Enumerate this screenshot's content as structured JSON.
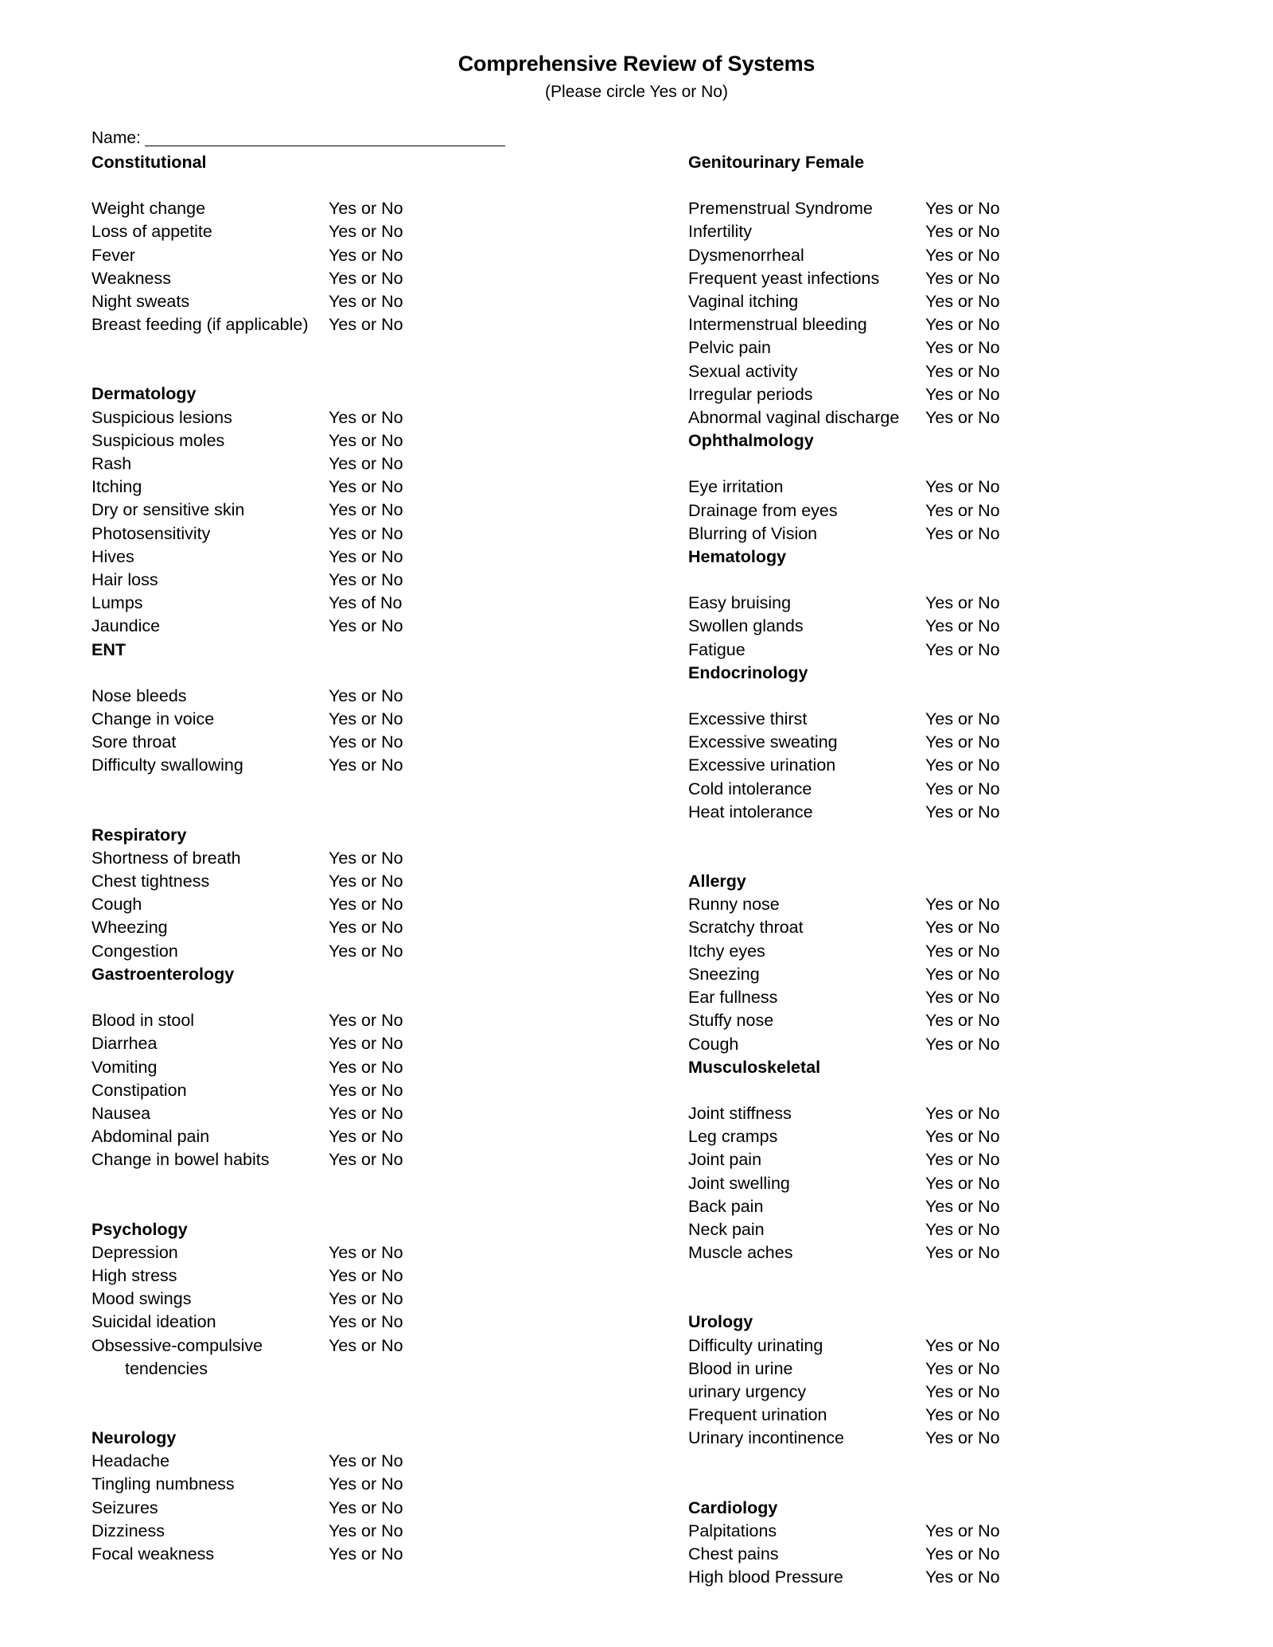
{
  "header": {
    "title": "Comprehensive Review of Systems",
    "subtitle": "(Please circle Yes or No)"
  },
  "name_field": {
    "label": "Name:",
    "value": ""
  },
  "answer_default": "Yes or No",
  "left_column": [
    {
      "heading": "Constitutional",
      "gap_after_heading": true,
      "space_before": false,
      "items": [
        {
          "label": "Weight change",
          "answer": "Yes or No"
        },
        {
          "label": "Loss of appetite",
          "answer": "Yes or No"
        },
        {
          "label": "Fever",
          "answer": "Yes or No"
        },
        {
          "label": "Weakness",
          "answer": "Yes or No"
        },
        {
          "label": "Night sweats",
          "answer": "Yes or No"
        },
        {
          "label": "Breast feeding (if applicable)",
          "answer": "Yes or No"
        }
      ]
    },
    {
      "heading": "Dermatology",
      "gap_after_heading": false,
      "space_before": true,
      "items": [
        {
          "label": "Suspicious lesions",
          "answer": "Yes or No"
        },
        {
          "label": "Suspicious moles",
          "answer": "Yes or No"
        },
        {
          "label": "Rash",
          "answer": "Yes or No"
        },
        {
          "label": "Itching",
          "answer": "Yes or No"
        },
        {
          "label": "Dry or sensitive skin",
          "answer": "Yes or No"
        },
        {
          "label": "Photosensitivity",
          "answer": "Yes or No"
        },
        {
          "label": "Hives",
          "answer": "Yes or No"
        },
        {
          "label": "Hair loss",
          "answer": "Yes or No"
        },
        {
          "label": "Lumps",
          "answer": "Yes of No"
        },
        {
          "label": "Jaundice",
          "answer": "Yes or No"
        }
      ]
    },
    {
      "heading": "ENT",
      "gap_after_heading": true,
      "space_before": false,
      "items": [
        {
          "label": "Nose bleeds",
          "answer": "Yes or No"
        },
        {
          "label": "Change in voice",
          "answer": "Yes or No"
        },
        {
          "label": "Sore throat",
          "answer": "Yes or No"
        },
        {
          "label": "Difficulty swallowing",
          "answer": "Yes or No"
        }
      ]
    },
    {
      "heading": "Respiratory",
      "gap_after_heading": false,
      "space_before": true,
      "items": [
        {
          "label": "Shortness of breath",
          "answer": "Yes or No"
        },
        {
          "label": "Chest tightness",
          "answer": "Yes or No"
        },
        {
          "label": "Cough",
          "answer": "Yes or No"
        },
        {
          "label": "Wheezing",
          "answer": "Yes or No"
        },
        {
          "label": "Congestion",
          "answer": "Yes or No"
        }
      ]
    },
    {
      "heading": "Gastroenterology",
      "gap_after_heading": true,
      "space_before": false,
      "items": [
        {
          "label": "Blood in stool",
          "answer": "Yes or No"
        },
        {
          "label": "Diarrhea",
          "answer": "Yes or No"
        },
        {
          "label": "Vomiting",
          "answer": "Yes or No"
        },
        {
          "label": "Constipation",
          "answer": "Yes or No"
        },
        {
          "label": "Nausea",
          "answer": "Yes or No"
        },
        {
          "label": "Abdominal pain",
          "answer": "Yes or No"
        },
        {
          "label": "Change in bowel habits",
          "answer": "Yes or No"
        }
      ]
    },
    {
      "heading": "Psychology",
      "gap_after_heading": false,
      "space_before": true,
      "items": [
        {
          "label": "Depression",
          "answer": "Yes or No"
        },
        {
          "label": "High stress",
          "answer": "Yes or No"
        },
        {
          "label": "Mood swings",
          "answer": "Yes or No"
        },
        {
          "label": "Suicidal ideation",
          "answer": "Yes or No"
        },
        {
          "label": "Obsessive-compulsive",
          "answer": "Yes or No"
        },
        {
          "label": "tendencies",
          "answer": "",
          "continuation": true
        }
      ]
    },
    {
      "heading": "Neurology",
      "gap_after_heading": false,
      "space_before": true,
      "items": [
        {
          "label": "Headache",
          "answer": "Yes or No"
        },
        {
          "label": "Tingling numbness",
          "answer": "Yes or No"
        },
        {
          "label": "Seizures",
          "answer": "Yes or No"
        },
        {
          "label": "Dizziness",
          "answer": "Yes or No"
        },
        {
          "label": "Focal weakness",
          "answer": "Yes or No"
        }
      ]
    }
  ],
  "right_column": [
    {
      "heading": "Genitourinary Female",
      "gap_after_heading": true,
      "space_before": false,
      "items": [
        {
          "label": "Premenstrual Syndrome",
          "answer": "Yes or No"
        },
        {
          "label": "Infertility",
          "answer": "Yes or No"
        },
        {
          "label": "Dysmenorrheal",
          "answer": "Yes or No"
        },
        {
          "label": "Frequent yeast infections",
          "answer": "Yes or No"
        },
        {
          "label": "Vaginal itching",
          "answer": "Yes or No"
        },
        {
          "label": "Intermenstrual bleeding",
          "answer": "Yes or No"
        },
        {
          "label": "Pelvic pain",
          "answer": "Yes or No"
        },
        {
          "label": "Sexual activity",
          "answer": "Yes or No"
        },
        {
          "label": "Irregular periods",
          "answer": "Yes or No"
        },
        {
          "label": "Abnormal vaginal discharge",
          "answer": "Yes or No"
        }
      ]
    },
    {
      "heading": "Ophthalmology",
      "gap_after_heading": true,
      "space_before": false,
      "items": [
        {
          "label": "Eye irritation",
          "answer": "Yes or No"
        },
        {
          "label": "Drainage from eyes",
          "answer": "Yes or No"
        },
        {
          "label": "Blurring of Vision",
          "answer": "Yes or No"
        }
      ]
    },
    {
      "heading": "Hematology",
      "gap_after_heading": true,
      "space_before": false,
      "items": [
        {
          "label": "Easy bruising",
          "answer": "Yes or No"
        },
        {
          "label": "Swollen glands",
          "answer": "Yes or No"
        },
        {
          "label": "Fatigue",
          "answer": "Yes or No"
        }
      ]
    },
    {
      "heading": "Endocrinology",
      "gap_after_heading": true,
      "space_before": false,
      "items": [
        {
          "label": "Excessive thirst",
          "answer": "Yes or No"
        },
        {
          "label": "Excessive sweating",
          "answer": "Yes or No"
        },
        {
          "label": "Excessive urination",
          "answer": "Yes or No"
        },
        {
          "label": "Cold intolerance",
          "answer": "Yes or No"
        },
        {
          "label": "Heat intolerance",
          "answer": "Yes or No"
        }
      ]
    },
    {
      "heading": "Allergy",
      "gap_after_heading": false,
      "space_before": true,
      "items": [
        {
          "label": "Runny nose",
          "answer": "Yes or No"
        },
        {
          "label": "Scratchy throat",
          "answer": "Yes or No"
        },
        {
          "label": "Itchy eyes",
          "answer": "Yes or No"
        },
        {
          "label": "Sneezing",
          "answer": "Yes or No"
        },
        {
          "label": "Ear fullness",
          "answer": "Yes or No"
        },
        {
          "label": "Stuffy nose",
          "answer": "Yes or No"
        },
        {
          "label": "Cough",
          "answer": "Yes or No"
        }
      ]
    },
    {
      "heading": "Musculoskeletal",
      "gap_after_heading": true,
      "space_before": false,
      "items": [
        {
          "label": "Joint stiffness",
          "answer": "Yes or No"
        },
        {
          "label": "Leg cramps",
          "answer": "Yes or No"
        },
        {
          "label": "Joint pain",
          "answer": "Yes or No"
        },
        {
          "label": "Joint swelling",
          "answer": "Yes or No"
        },
        {
          "label": "Back pain",
          "answer": "Yes or No"
        },
        {
          "label": "Neck pain",
          "answer": "Yes or No"
        },
        {
          "label": "Muscle aches",
          "answer": "Yes or No"
        }
      ]
    },
    {
      "heading": "Urology",
      "gap_after_heading": false,
      "space_before": true,
      "items": [
        {
          "label": "Difficulty urinating",
          "answer": "Yes or No"
        },
        {
          "label": "Blood in urine",
          "answer": "Yes or No"
        },
        {
          "label": "urinary urgency",
          "answer": "Yes or No"
        },
        {
          "label": "Frequent urination",
          "answer": "Yes or No"
        },
        {
          "label": "Urinary incontinence",
          "answer": "Yes or No"
        }
      ]
    },
    {
      "heading": "Cardiology",
      "gap_after_heading": false,
      "space_before": true,
      "items": [
        {
          "label": "Palpitations",
          "answer": "Yes or No"
        },
        {
          "label": "Chest pains",
          "answer": "Yes or No"
        },
        {
          "label": "High blood Pressure",
          "answer": "Yes or No"
        }
      ]
    }
  ]
}
